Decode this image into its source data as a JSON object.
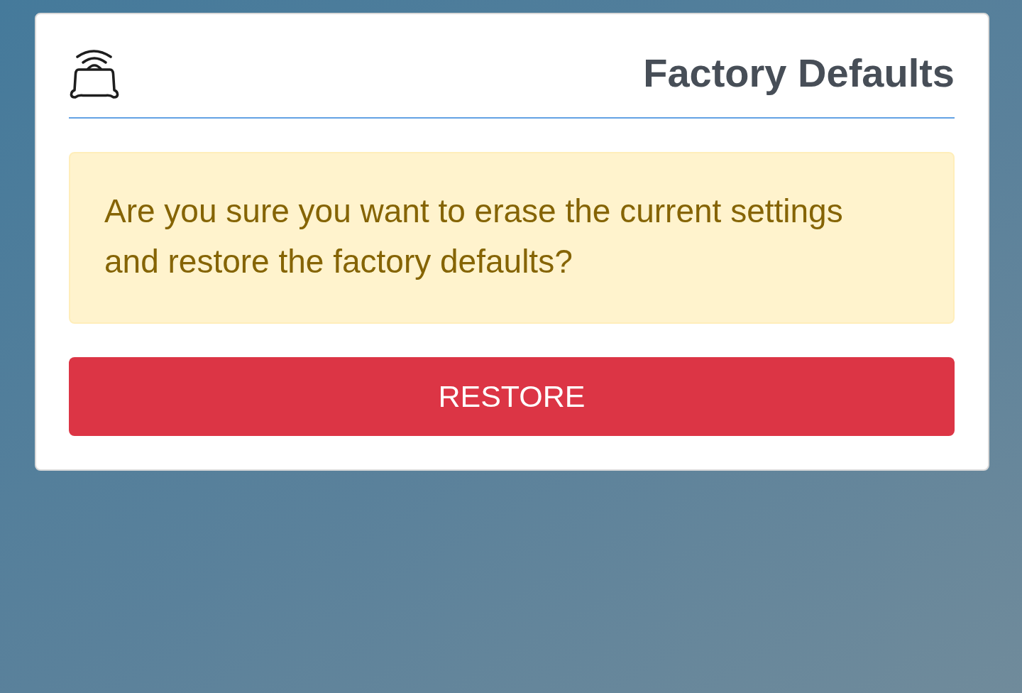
{
  "header": {
    "title": "Factory Defaults"
  },
  "alert": {
    "message": "Are you sure you want to erase the current settings and restore the factory defaults?"
  },
  "restore_button": {
    "label": "RESTORE"
  }
}
